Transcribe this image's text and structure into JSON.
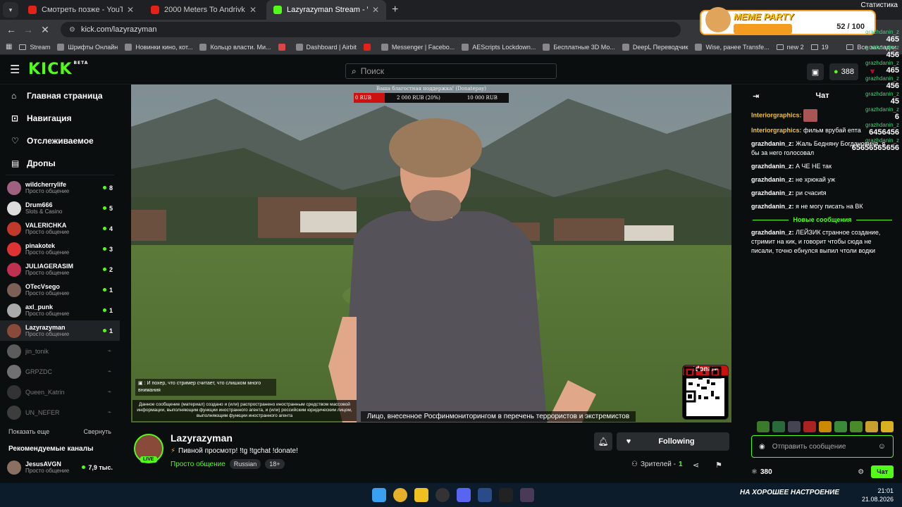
{
  "browser": {
    "tabs": [
      {
        "title": "Смотреть позже - YouTube",
        "color": "#e62117"
      },
      {
        "title": "2000 Meters To Andrivka | JESI",
        "color": "#e62117"
      },
      {
        "title": "Lazyrazyman Stream - Watc",
        "color": "#53fc18"
      }
    ],
    "new_tab": "+",
    "url": "kick.com/lazyrazyman",
    "bookmarks": [
      {
        "label": "Stream",
        "type": "folder"
      },
      {
        "label": "Шрифты Онлайн",
        "type": "link"
      },
      {
        "label": "Новинки кино, кот...",
        "type": "link"
      },
      {
        "label": "Кольцо власти. Ми...",
        "type": "link"
      },
      {
        "label": "",
        "type": "gmail"
      },
      {
        "label": "Dashboard | Airbit",
        "type": "link"
      },
      {
        "label": "",
        "type": "youtube"
      },
      {
        "label": "Messenger | Facebo...",
        "type": "link"
      },
      {
        "label": "AEScripts Lockdown...",
        "type": "link"
      },
      {
        "label": "Бесплатные 3D Мо...",
        "type": "link"
      },
      {
        "label": "DeepL Переводчик",
        "type": "link"
      },
      {
        "label": "Wise, ранее Transfe...",
        "type": "link"
      },
      {
        "label": "new 2",
        "type": "folder"
      },
      {
        "label": "19",
        "type": "folder"
      }
    ],
    "all_bookmarks": "Все закладки"
  },
  "overlay": {
    "stats_label": "Статистика",
    "meme_title": "MEME PARTY",
    "meme_value": "52 / 100",
    "meme_progress": 0.52,
    "entries": [
      {
        "name": "grazhdanin_z",
        "value": "465"
      },
      {
        "name": "grazhdanin_z",
        "value": "456"
      },
      {
        "name": "grazhdanin_z",
        "value": "465"
      },
      {
        "name": "grazhdanin_z",
        "value": "456"
      },
      {
        "name": "grazhdanin_z",
        "value": "45"
      },
      {
        "name": "grazhdanin_z",
        "value": "6"
      },
      {
        "name": "grazhdanin_z",
        "value": "6456456"
      },
      {
        "name": "grazhdanin_z",
        "value": "65656565656"
      }
    ]
  },
  "kick": {
    "logo": "KICK",
    "beta": "BETA",
    "search_placeholder": "Поиск",
    "points": "388",
    "nav": [
      {
        "label": "Главная страница",
        "icon": "home-icon"
      },
      {
        "label": "Навигация",
        "icon": "compass-icon"
      },
      {
        "label": "Отслеживаемое",
        "icon": "heart-icon"
      },
      {
        "label": "Дропы",
        "icon": "gift-icon"
      }
    ],
    "channels": [
      {
        "name": "wildcherrylife",
        "category": "Просто общение",
        "viewers": "8",
        "online": true,
        "color": "#a06080"
      },
      {
        "name": "Drum666",
        "category": "Slots & Casino",
        "viewers": "5",
        "online": true,
        "color": "#ddd"
      },
      {
        "name": "VALERICHKA",
        "category": "Просто общение",
        "viewers": "4",
        "online": true,
        "color": "#c0392b"
      },
      {
        "name": "pinakotek",
        "category": "Просто общение",
        "viewers": "3",
        "online": true,
        "color": "#d33"
      },
      {
        "name": "JULIAGERASIM",
        "category": "Просто общение",
        "viewers": "2",
        "online": true,
        "color": "#c03050"
      },
      {
        "name": "OTecVsego",
        "category": "Просто общение",
        "viewers": "1",
        "online": true,
        "color": "#7a6055"
      },
      {
        "name": "axl_punk",
        "category": "Просто общение",
        "viewers": "1",
        "online": true,
        "color": "#aaa"
      },
      {
        "name": "Lazyrazyman",
        "category": "Просто общение",
        "viewers": "1",
        "online": true,
        "active": true,
        "color": "#8a4a3a"
      },
      {
        "name": "jin_tonik",
        "category": "",
        "viewers": "",
        "online": false,
        "color": "#999"
      },
      {
        "name": "GRPZDC",
        "category": "",
        "viewers": "",
        "online": false,
        "color": "#bbb"
      },
      {
        "name": "Queen_Katrin",
        "category": "",
        "viewers": "",
        "online": false,
        "color": "#555"
      },
      {
        "name": "UN_NEFER",
        "category": "",
        "viewers": "",
        "online": false,
        "color": "#666"
      }
    ],
    "show_more": "Показать еще",
    "collapse": "Свернуть",
    "recommended_title": "Рекомендуемые каналы",
    "recommended": [
      {
        "name": "JesusAVGN",
        "category": "Просто общение",
        "viewers": "7,9 тыс.",
        "color": "#8a7060"
      }
    ]
  },
  "video": {
    "donation_title": "Ваша благостная поддержка! (Donatepay)",
    "donation_min": "0 RUB",
    "donation_mid": "2 000 RUB (20%)",
    "donation_max": "10 000 RUB",
    "donation_progress": 0.2,
    "alert_text": ": И похер, что стример считает, что слишком много внимания",
    "agent_notice": "Данное сообщение (материал) создано и (или) распространено иностранным средством массовой информации, выполняющим функции иностранного агента, и (или) российским юридическим лицом, выполняющим функции иностранного агента",
    "terror_notice": "Лицо, внесенное Росфинмониторингом в перечень террористов и экстремистов",
    "donate_label": "!donate"
  },
  "stream": {
    "streamer": "Lazyrazyman",
    "live": "LIVE",
    "title": "Пивной просмотр! !tg !tgchat !donate!",
    "category": "Просто общение",
    "tags": [
      "Russian",
      "18+"
    ],
    "follow_label": "Following",
    "viewers_label": "Зрителей -",
    "viewers": "1"
  },
  "chat": {
    "title": "Чат",
    "messages": [
      {
        "user": "Interiorgraphics:",
        "text": "",
        "emote": true,
        "yellow": true
      },
      {
        "user": "Interiorgraphics:",
        "text": "фильм врубай епта",
        "yellow": true
      },
      {
        "user": "grazhdanin_z:",
        "text": "Жаль Бедняну Богдановича, я бы за него голосовал"
      },
      {
        "user": "grazhdanin_z:",
        "text": "А ЧЕ НЕ так"
      },
      {
        "user": "grazhdanin_z:",
        "text": "не хрюкай уж"
      },
      {
        "user": "grazhdanin_z:",
        "text": "ри счасиtя"
      },
      {
        "user": "grazhdanin_z:",
        "text": "я не могу писать на ВК"
      }
    ],
    "new_messages": "Новые сообщения",
    "new_message": {
      "user": "grazhdanin_z:",
      "text": "ЛЕЙЗИК странное создание, стримит на кик, и говорит чтобы сюда не писали, точно ебнулся выпил чтоли водки"
    },
    "input_placeholder": "Отправить сообщение",
    "points": "380",
    "send_label": "Чат"
  },
  "taskbar": {
    "banner": "НА ХОРОШЕЕ НАСТРОЕНИЕ",
    "time": "21:01",
    "date": "21.08.2026"
  }
}
